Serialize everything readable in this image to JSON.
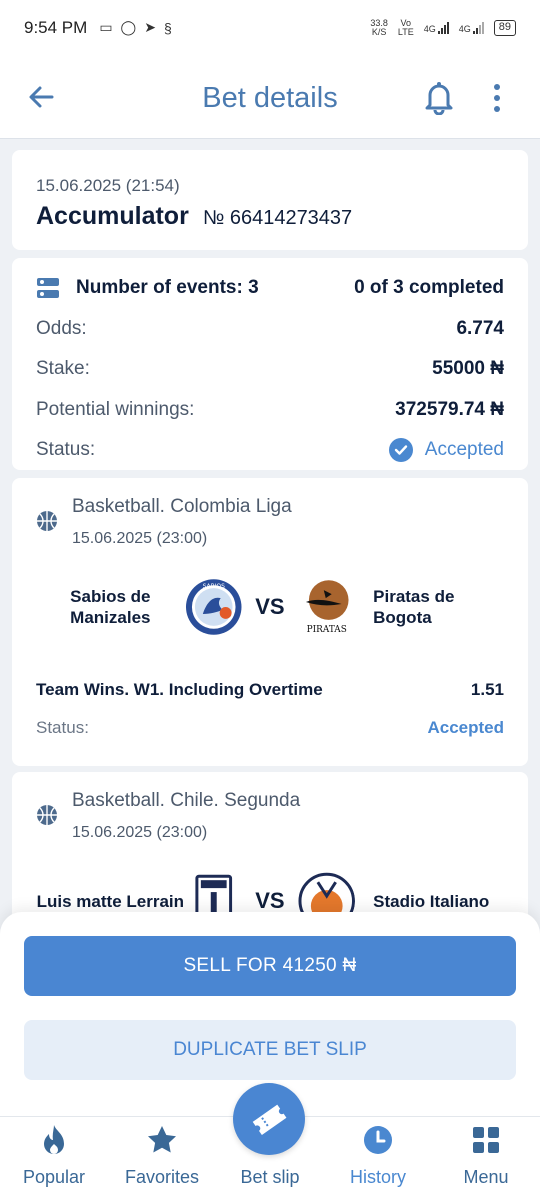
{
  "status_bar": {
    "time": "9:54 PM",
    "speed_value": "33.8",
    "speed_unit": "K/S",
    "volte_top": "Vo",
    "volte_bottom": "LTE",
    "net1": "4G",
    "net2": "4G",
    "battery": "89"
  },
  "header": {
    "title": "Bet details"
  },
  "bet": {
    "date": "15.06.2025 (21:54)",
    "type": "Accumulator",
    "number": "№ 66414273437"
  },
  "summary": {
    "events_label": "Number of events: 3",
    "events_completed": "0 of 3 completed",
    "odds_label": "Odds:",
    "odds_value": "6.774",
    "stake_label": "Stake:",
    "stake_value": "55000 ₦",
    "winnings_label": "Potential winnings:",
    "winnings_value": "372579.74 ₦",
    "status_label": "Status:",
    "status_value": "Accepted"
  },
  "events": [
    {
      "league": "Basketball. Colombia Liga",
      "date": "15.06.2025 (23:00)",
      "home": "Sabios de Manizales",
      "away": "Piratas de Bogota",
      "home_logo_text": "SABIOS",
      "away_logo_text": "PIRATAS",
      "vs": "VS",
      "market": "Team Wins. W1. Including Overtime",
      "odds": "1.51",
      "status_label": "Status:",
      "status_value": "Accepted"
    },
    {
      "league": "Basketball. Chile. Segunda",
      "date": "15.06.2025 (23:00)",
      "home": "Luis matte Lerrain",
      "away": "Stadio Italiano",
      "vs": "VS"
    }
  ],
  "actions": {
    "sell": "SELL FOR 41250 ₦",
    "duplicate": "DUPLICATE BET SLIP"
  },
  "nav": [
    {
      "label": "Popular",
      "icon": "fire-icon"
    },
    {
      "label": "Favorites",
      "icon": "star-icon"
    },
    {
      "label": "Bet slip",
      "icon": "ticket-icon"
    },
    {
      "label": "History",
      "icon": "clock-icon"
    },
    {
      "label": "Menu",
      "icon": "grid-icon"
    }
  ],
  "colors": {
    "accent": "#4a86d2",
    "title": "#4a7ab0",
    "text": "#0f1e3a",
    "muted": "#4d5a6c"
  }
}
